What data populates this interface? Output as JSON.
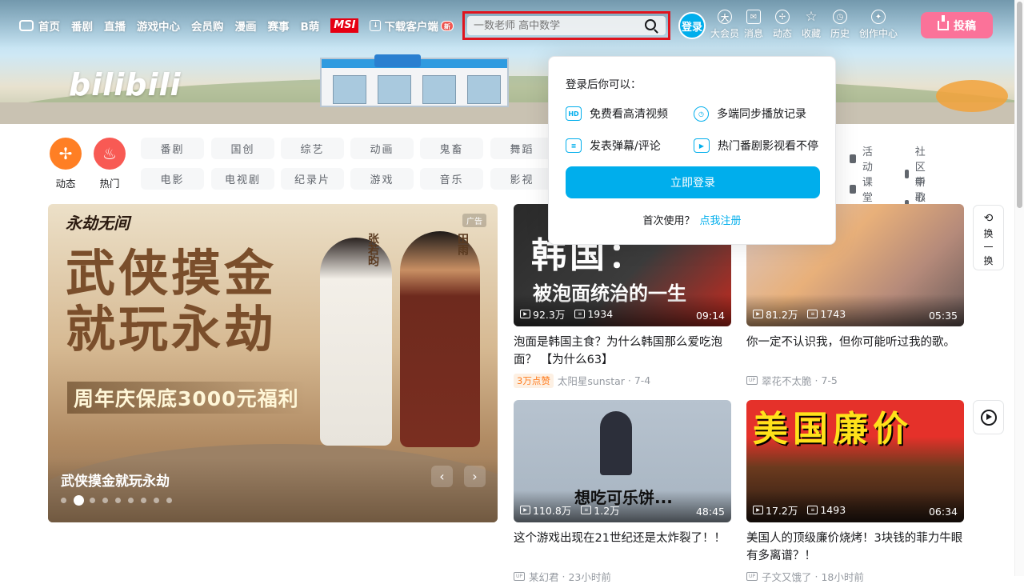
{
  "nav": {
    "items": [
      "首页",
      "番剧",
      "直播",
      "游戏中心",
      "会员购",
      "漫画",
      "赛事",
      "B萌"
    ],
    "msi": "MSI",
    "download": "下载客户端",
    "download_badge": "新"
  },
  "logo": "bilibili",
  "search": {
    "placeholder": "一数老师 高中数学"
  },
  "login": "登录",
  "right_nav": [
    "大会员",
    "消息",
    "动态",
    "收藏",
    "历史",
    "创作中心"
  ],
  "upload": "投稿",
  "big_cats": [
    {
      "label": "动态",
      "color": "#ff7f24"
    },
    {
      "label": "热门",
      "color": "#f85a54"
    }
  ],
  "chips_row1": [
    "番剧",
    "国创",
    "综艺",
    "动画",
    "鬼畜",
    "舞蹈"
  ],
  "chips_row2": [
    "电影",
    "电视剧",
    "纪录片",
    "游戏",
    "音乐",
    "影视"
  ],
  "right_links": [
    "活动",
    "社区中心",
    "课堂",
    "新歌热榜"
  ],
  "hero": {
    "brand": "永劫无间",
    "ad_tag": "广告",
    "headline1": "武侠摸金",
    "headline2": "就玩永劫",
    "promo": "周年庆保底3000元福利",
    "name1": "张若昀",
    "name2": "田雨",
    "caption": "武侠摸金就玩永劫",
    "prev": "‹",
    "next": "›"
  },
  "videos": [
    {
      "overlay": "韩国：被泡面统治的一生",
      "plays": "92.3万",
      "danmaku": "1934",
      "duration": "09:14",
      "title": "泡面是韩国主食？为什么韩国那么爱吃泡面？ 【为什么63】",
      "hot": "3万点赞",
      "author": "太阳星sunstar",
      "date": "7-4"
    },
    {
      "overlay": "",
      "plays": "81.2万",
      "danmaku": "1743",
      "duration": "05:35",
      "title": "你一定不认识我，但你可能听过我的歌。",
      "hot": "",
      "author": "翠花不太脆",
      "date": "7-5"
    },
    {
      "overlay": "想吃可乐饼...",
      "plays": "110.8万",
      "danmaku": "1.2万",
      "duration": "48:45",
      "title": "这个游戏出现在21世纪还是太炸裂了！！",
      "hot": "",
      "author": "某幻君",
      "date": "23小时前"
    },
    {
      "overlay": "美国廉价",
      "plays": "17.2万",
      "danmaku": "1493",
      "duration": "06:34",
      "title": "美国人的顶级廉价烧烤！3块钱的菲力牛眼有多离谱？！",
      "hot": "",
      "author": "子文又饿了",
      "date": "18小时前"
    }
  ],
  "side": {
    "refresh": "换",
    "refresh2": "一",
    "refresh3": "换"
  },
  "popup": {
    "heading": "登录后你可以：",
    "features": [
      "免费看高清视频",
      "多端同步播放记录",
      "发表弹幕/评论",
      "热门番剧影视看不停"
    ],
    "button": "立即登录",
    "first": "首次使用？",
    "register": "点我注册"
  }
}
